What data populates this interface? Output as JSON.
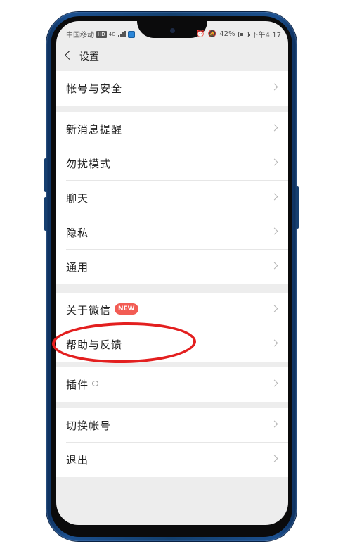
{
  "status_bar": {
    "carrier": "中国移动",
    "network_badge": "HD",
    "network_type": "4G",
    "battery": "42%",
    "time": "下午4:17"
  },
  "header": {
    "title": "设置"
  },
  "settings": {
    "account_security": "帐号与安全",
    "new_message_alerts": "新消息提醒",
    "do_not_disturb": "勿扰模式",
    "chat": "聊天",
    "privacy": "隐私",
    "general": "通用",
    "about_wechat": "关于微信",
    "new_badge": "NEW",
    "help_feedback": "帮助与反馈",
    "plugins": "插件",
    "switch_account": "切换帐号",
    "logout": "退出"
  },
  "colors": {
    "highlight": "#e31f1f",
    "badge": "#f25c54",
    "phone_frame": "#13406f"
  }
}
